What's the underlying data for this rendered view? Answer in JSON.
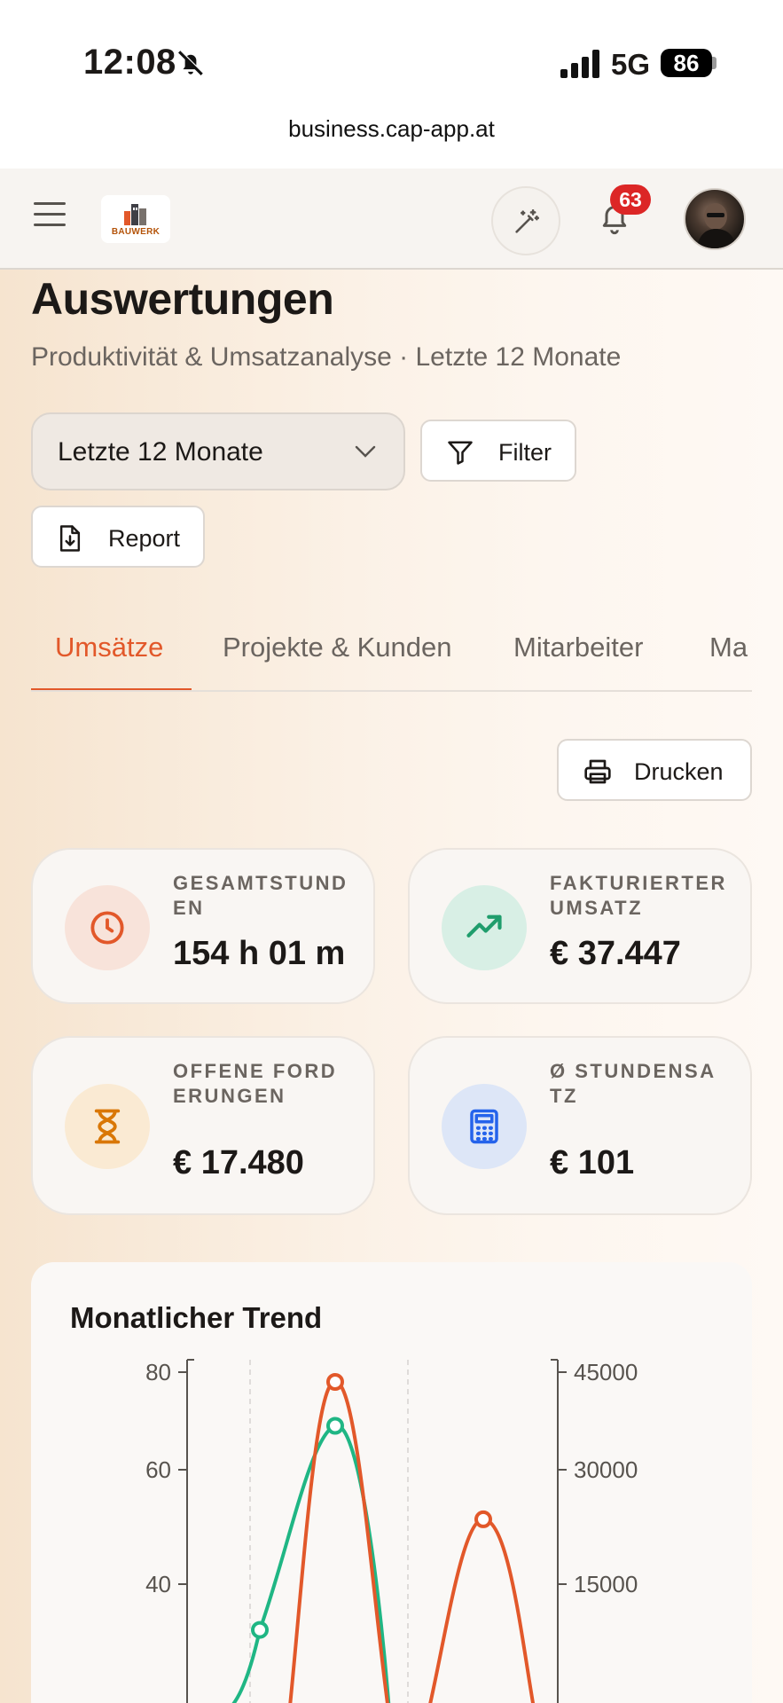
{
  "status_bar": {
    "time": "12:08",
    "network": "5G",
    "battery": "86"
  },
  "browser": {
    "url": "business.cap-app.at"
  },
  "header": {
    "logo_text": "BAUWERK",
    "notification_count": "63"
  },
  "page": {
    "title": "Auswertungen",
    "subtitle": "Produktivität & Umsatzanalyse · Letzte 12 Monate"
  },
  "controls": {
    "period_value": "Letzte 12 Monate",
    "filter_label": "Filter",
    "report_label": "Report",
    "print_label": "Drucken"
  },
  "tabs": [
    {
      "label": "Umsätze",
      "active": true
    },
    {
      "label": "Projekte & Kunden",
      "active": false
    },
    {
      "label": "Mitarbeiter",
      "active": false
    },
    {
      "label": "Ma",
      "active": false
    }
  ],
  "kpis": [
    {
      "label": "GESAMTSTUNDEN",
      "value": "154 h 01 m",
      "icon": "clock-icon",
      "color": "#e2582a",
      "bg": "#f8e3da"
    },
    {
      "label": "FAKTURIERTER UMSATZ",
      "value": "€ 37.447",
      "icon": "trending-up-icon",
      "color": "#1f9d6c",
      "bg": "#d8efe5"
    },
    {
      "label": "OFFENE FORDERUNGEN",
      "value": "€ 17.480",
      "icon": "hourglass-icon",
      "color": "#d97706",
      "bg": "#faead3"
    },
    {
      "label": "Ø STUNDENSATZ",
      "value": "€ 101",
      "icon": "calculator-icon",
      "color": "#2563eb",
      "bg": "#dde6f7"
    }
  ],
  "chart": {
    "title": "Monatlicher Trend",
    "colors": {
      "hours": "#1fb684",
      "revenue": "#e2582a"
    },
    "left_ticks": [
      "80",
      "60",
      "40"
    ],
    "right_ticks": [
      "45000",
      "30000",
      "15000"
    ]
  },
  "chart_data": {
    "type": "line",
    "title": "Monatlicher Trend",
    "y_left_range": [
      0,
      80
    ],
    "y_right_range": [
      0,
      45000
    ],
    "left_ticks": [
      40,
      60,
      80
    ],
    "right_ticks": [
      15000,
      30000,
      45000
    ],
    "grid": "vertical dashed",
    "series": [
      {
        "axis": "left",
        "color": "#1fb684",
        "points": [
          32,
          69
        ]
      },
      {
        "axis": "right",
        "color": "#e2582a",
        "points": [
          43500,
          23500
        ]
      }
    ]
  }
}
